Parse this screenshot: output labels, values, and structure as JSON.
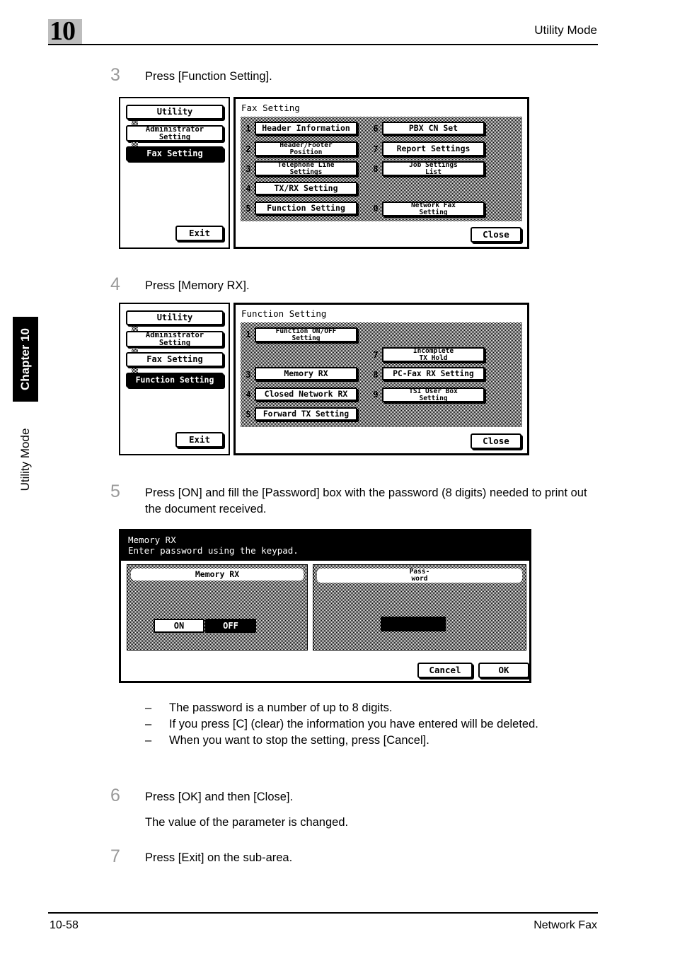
{
  "header": {
    "chapter_number": "10",
    "title": "Utility Mode"
  },
  "side_tab": {
    "chapter_label": "Chapter 10",
    "section_label": "Utility Mode"
  },
  "footer": {
    "page_number": "10-58",
    "doc_title": "Network Fax"
  },
  "steps": [
    {
      "num": "3",
      "text": "Press [Function Setting]."
    },
    {
      "num": "4",
      "text": "Press [Memory RX]."
    },
    {
      "num": "5",
      "text": "Press [ON] and fill the [Password] box with the password (8 digits) needed to print out the document received."
    },
    {
      "num": "6",
      "text": "Press [OK] and then [Close].",
      "sub": "The value of the parameter is changed."
    },
    {
      "num": "7",
      "text": "Press [Exit] on the sub-area."
    }
  ],
  "notes": {
    "dash": "–",
    "items": [
      "The password is a number of up to 8 digits.",
      "If you press [C] (clear) the information you have entered will be deleted.",
      "When you want to stop the setting, press [Cancel]."
    ]
  },
  "screen_fax_setting": {
    "sidebar": {
      "items": [
        {
          "label": "Utility",
          "selected": false
        },
        {
          "label": "Administrator\nSetting",
          "selected": false
        },
        {
          "label": "Fax Setting",
          "selected": true
        }
      ],
      "exit_label": "Exit"
    },
    "title": "Fax Setting",
    "close_label": "Close",
    "left_column": [
      {
        "key": "1",
        "label": "Header Information"
      },
      {
        "key": "2",
        "label": "Header/Footer\nPosition"
      },
      {
        "key": "3",
        "label": "Telephone Line\nSettings"
      },
      {
        "key": "4",
        "label": "TX/RX Setting"
      },
      {
        "key": "5",
        "label": "Function Setting"
      }
    ],
    "right_column": [
      {
        "key": "6",
        "label": "PBX CN Set"
      },
      {
        "key": "7",
        "label": "Report Settings"
      },
      {
        "key": "8",
        "label": "Job Settings\nList"
      },
      {
        "key": "0",
        "label": "Network Fax\nSetting"
      }
    ]
  },
  "screen_function_setting": {
    "sidebar": {
      "items": [
        {
          "label": "Utility",
          "selected": false
        },
        {
          "label": "Administrator\nSetting",
          "selected": false
        },
        {
          "label": "Fax Setting",
          "selected": false
        },
        {
          "label": "Function Setting",
          "selected": true
        }
      ],
      "exit_label": "Exit"
    },
    "title": "Function Setting",
    "close_label": "Close",
    "left_column": [
      {
        "key": "1",
        "label": "Function ON/OFF\nSetting"
      },
      {
        "key": "3",
        "label": "Memory RX"
      },
      {
        "key": "4",
        "label": "Closed Network RX"
      },
      {
        "key": "5",
        "label": "Forward TX Setting"
      }
    ],
    "right_column": [
      {
        "key": "7",
        "label": "Incomplete\nTX Hold"
      },
      {
        "key": "8",
        "label": "PC-Fax RX Setting"
      },
      {
        "key": "9",
        "label": "TSI User Box\nSetting"
      }
    ]
  },
  "screen_memory_rx": {
    "title_line1": "Memory RX",
    "title_line2": "Enter password using the keypad.",
    "left_group_label": "Memory RX",
    "right_group_label": "Pass-\nword",
    "toggle": {
      "on_label": "ON",
      "off_label": "OFF",
      "selected": "OFF"
    },
    "password_value": "",
    "cancel_label": "Cancel",
    "ok_label": "OK"
  }
}
